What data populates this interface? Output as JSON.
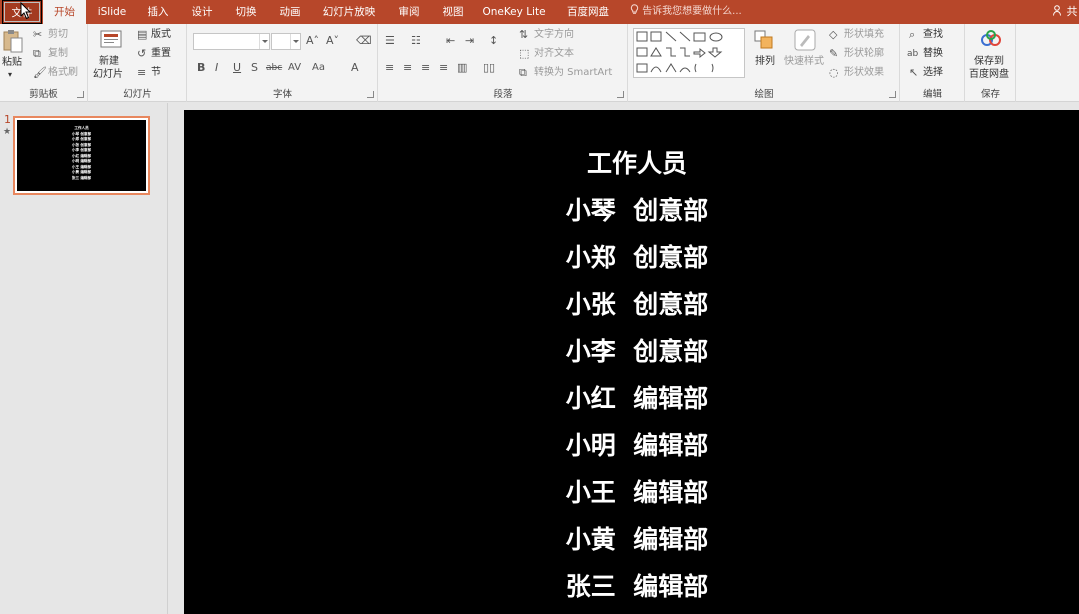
{
  "tabs": [
    {
      "label": "文件",
      "state": "file"
    },
    {
      "label": "开始",
      "state": "active"
    },
    {
      "label": "iSlide",
      "state": ""
    },
    {
      "label": "插入",
      "state": ""
    },
    {
      "label": "设计",
      "state": ""
    },
    {
      "label": "切换",
      "state": ""
    },
    {
      "label": "动画",
      "state": ""
    },
    {
      "label": "幻灯片放映",
      "state": ""
    },
    {
      "label": "审阅",
      "state": ""
    },
    {
      "label": "视图",
      "state": ""
    },
    {
      "label": "OneKey Lite",
      "state": ""
    },
    {
      "label": "百度网盘",
      "state": ""
    }
  ],
  "tell_me": "告诉我您想要做什么...",
  "share_label": "共",
  "ribbon": {
    "clipboard": {
      "group": "剪贴板",
      "paste": "粘贴",
      "cut": "剪切",
      "copy": "复制",
      "format_painter": "格式刷"
    },
    "slides": {
      "group": "幻灯片",
      "new_slide_1": "新建",
      "new_slide_2": "幻灯片",
      "layout": "版式",
      "reset": "重置",
      "section": "节"
    },
    "font": {
      "group": "字体"
    },
    "paragraph": {
      "group": "段落",
      "text_direction": "文字方向",
      "align_text": "对齐文本",
      "smartart": "转换为 SmartArt"
    },
    "drawing": {
      "group": "绘图",
      "arrange": "排列",
      "quick_styles": "快速样式",
      "shape_fill": "形状填充",
      "shape_outline": "形状轮廓",
      "shape_effects": "形状效果"
    },
    "editing": {
      "group": "编辑",
      "find": "查找",
      "replace": "替换",
      "select": "选择"
    },
    "save": {
      "group": "保存",
      "save_to_1": "保存到",
      "save_to_2": "百度网盘"
    }
  },
  "thumbnail": {
    "number": "1",
    "star": "★"
  },
  "slide": {
    "lines": [
      "工作人员",
      "小琴  创意部",
      "小郑  创意部",
      "小张  创意部",
      "小李  创意部",
      "小红  编辑部",
      "小明  编辑部",
      "小王  编辑部",
      "小黄  编辑部",
      "张三  编辑部"
    ]
  },
  "colors": {
    "accent": "#b7472a",
    "slide_bg": "#000000",
    "slide_text": "#ffffff",
    "thumb_border": "#e8875e"
  }
}
